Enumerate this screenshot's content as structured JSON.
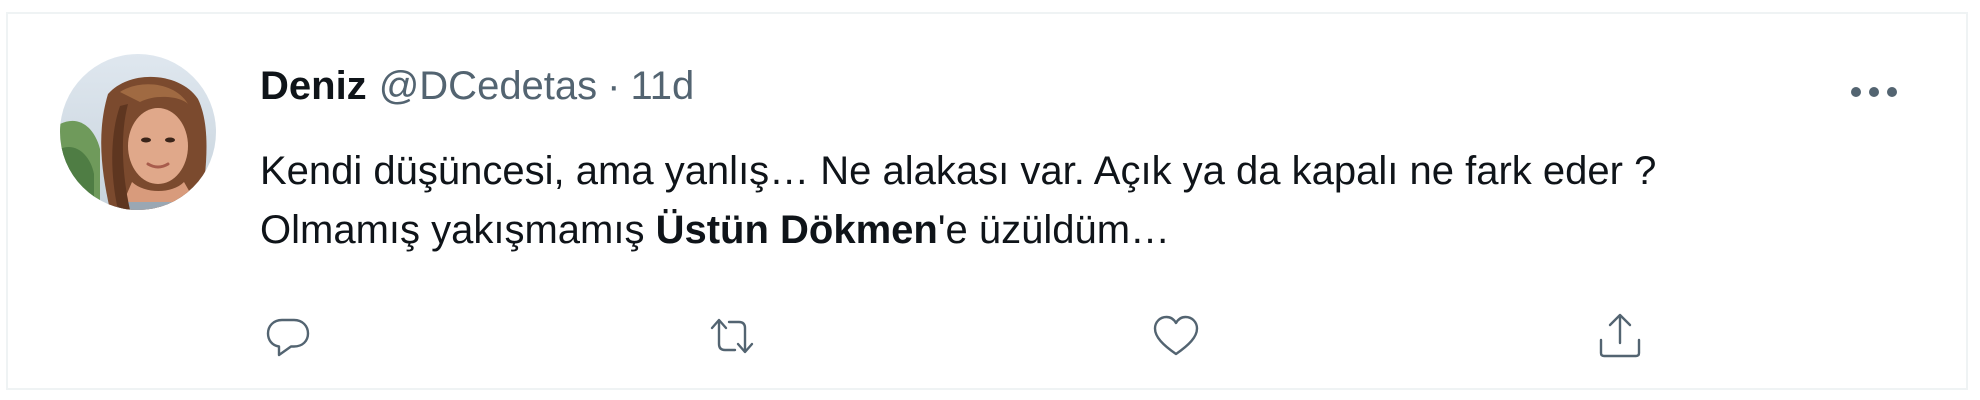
{
  "tweet": {
    "author": {
      "display_name": "Deniz",
      "handle": "@DCedetas"
    },
    "separator": "·",
    "timestamp": "11d",
    "text": {
      "line1": "Kendi düşüncesi, ama yanlış… Ne alakası var. Açık ya da kapalı ne fark eder ?",
      "line2_prefix": "Olmamış yakışmamış ",
      "line2_bold": "Üstün Dökmen",
      "line2_suffix": "'e üzüldüm…"
    }
  },
  "icons": {
    "more": "more-horizontal-icon",
    "reply": "reply-bubble-icon",
    "retweet": "retweet-icon",
    "like": "heart-icon",
    "share": "share-upload-icon"
  },
  "colors": {
    "text_primary": "#0f1419",
    "text_secondary": "#536471",
    "border": "#eff3f4"
  }
}
